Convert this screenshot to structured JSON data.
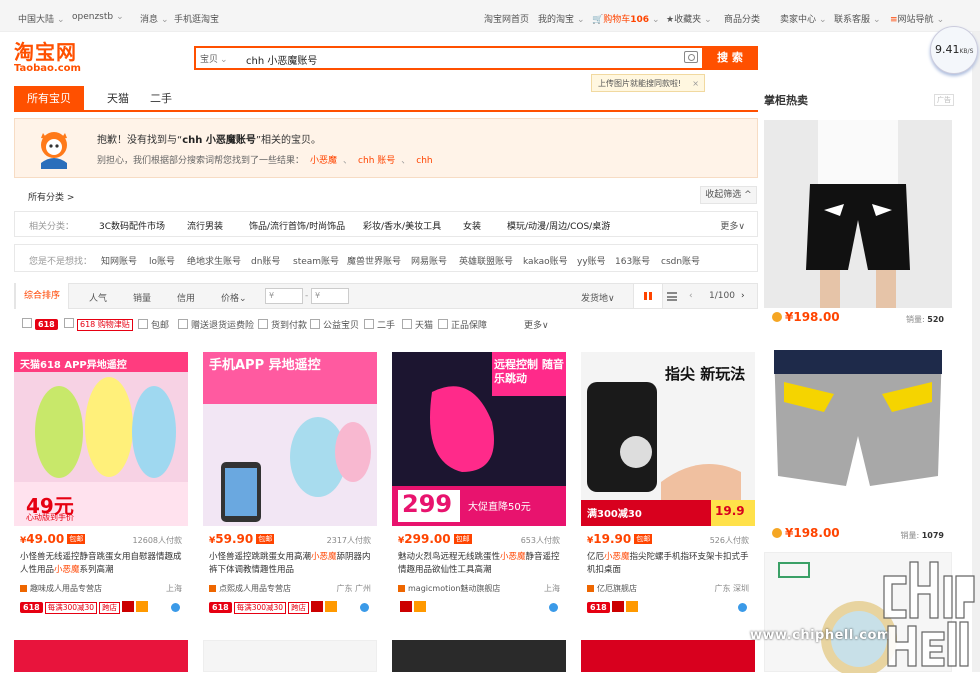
{
  "topbar": {
    "region": "中国大陆",
    "user": "openzstb",
    "messages": "消息",
    "mobile": "手机逛淘宝",
    "home": "淘宝网首页",
    "my_taobao": "我的淘宝",
    "cart": "购物车",
    "cart_count": "106",
    "favorites": "收藏夹",
    "categories": "商品分类",
    "seller_center": "卖家中心",
    "service": "联系客服",
    "site_nav": "网站导航"
  },
  "logo": {
    "cn": "淘宝网",
    "en": "Taobao.com"
  },
  "search": {
    "category": "宝贝",
    "value": "chh 小恶魔账号",
    "button": "搜 索"
  },
  "image_search_tip": "上传图片就能搜同款啦!",
  "speed": {
    "value": "9.41",
    "unit": "KB/S"
  },
  "tabs": [
    "所有宝贝",
    "天猫",
    "二手"
  ],
  "notice": {
    "line1_pre": "抱歉！没有找到与“",
    "line1_query": "chh 小恶魔账号",
    "line1_post": "”相关的宝贝。",
    "line2": "别担心，我们根据部分搜索词帮您找到了一些结果：",
    "suggestions": [
      "小恶魔",
      "chh 账号",
      "chh"
    ]
  },
  "all_categories": "所有分类 >",
  "collapse_filter": "收起筛选 ^",
  "related_categories": {
    "label": "相关分类：",
    "items": [
      "3C数码配件市场",
      "流行男装",
      "饰品/流行首饰/时尚饰品",
      "彩妆/香水/美妆工具",
      "女装",
      "模玩/动漫/周边/COS/桌游"
    ],
    "more": "更多∨"
  },
  "guess": {
    "label": "您是不是想找：",
    "items": [
      "知网账号",
      "lo账号",
      "绝地求生账号",
      "dn账号",
      "steam账号",
      "魔兽世界账号",
      "网易账号",
      "英雄联盟账号",
      "kakao账号",
      "yy账号",
      "163账号",
      "csdn账号"
    ]
  },
  "sort": {
    "items": [
      "综合排序",
      "人气",
      "销量",
      "信用",
      "价格"
    ],
    "price_from": "¥",
    "price_to": "¥",
    "ship_from": "发货地∨",
    "pager": "1/100"
  },
  "filters": [
    "618",
    "618 购物津贴",
    "包邮",
    "赠送退货运费险",
    "货到付款",
    "公益宝贝",
    "二手",
    "天猫",
    "正品保障"
  ],
  "filters_more": "更多∨",
  "products": [
    {
      "price": "49.00",
      "sales": "12608人付款",
      "title_pre": "小怪兽无线遥控静音跳蛋女用自慰器情趣成人性用品",
      "title_hl": "小恶魔",
      "title_post": "系列高潮",
      "shop": "趣味成人用品专营店",
      "loc": "上海",
      "banner": "天猫618 APP异地遥控",
      "big": "49元",
      "sub": "心动版到手价"
    },
    {
      "price": "59.90",
      "sales": "2317人付款",
      "title_pre": "小怪兽遥控跳跳蛋女用高潮",
      "title_hl": "小恶魔",
      "title_post": "舔阴器内裤下体调教情趣性用品",
      "shop": "点熙成人用品专营店",
      "loc": "广东 广州",
      "banner": "手机APP 异地遥控",
      "big": "",
      "sub": ""
    },
    {
      "price": "299.00",
      "sales": "653人付款",
      "title_pre": "魅动火烈鸟远程无线跳蛋性",
      "title_hl": "小恶魔",
      "title_post": "静音遥控情趣用品欲仙性工具高潮",
      "shop": "magicmotion魅动旗舰店",
      "loc": "上海",
      "banner": "远程控制 随音乐跳动",
      "big": "299",
      "sub": "大促直降50元"
    },
    {
      "price": "19.90",
      "sales": "526人付款",
      "title_pre": "亿厄",
      "title_hl": "小恶魔",
      "title_post": "指尖陀螺手机指环支架卡扣式手机扣桌面",
      "shop": "亿厄旗舰店",
      "loc": "广东 深圳",
      "banner": "指尖 新玩法",
      "big": "19.9",
      "sub": "满300减30"
    }
  ],
  "card_badges": [
    "618",
    "每满300减30",
    "跨店"
  ],
  "sidebar": {
    "title": "掌柜热卖",
    "ad": "广告",
    "items": [
      {
        "price": "¥198.00",
        "sales_label": "销量:",
        "sales": "520"
      },
      {
        "price": "¥198.00",
        "sales_label": "销量:",
        "sales": "1079"
      }
    ]
  },
  "watermark": "www.chiphell.com",
  "chip_logo": "chip hell"
}
